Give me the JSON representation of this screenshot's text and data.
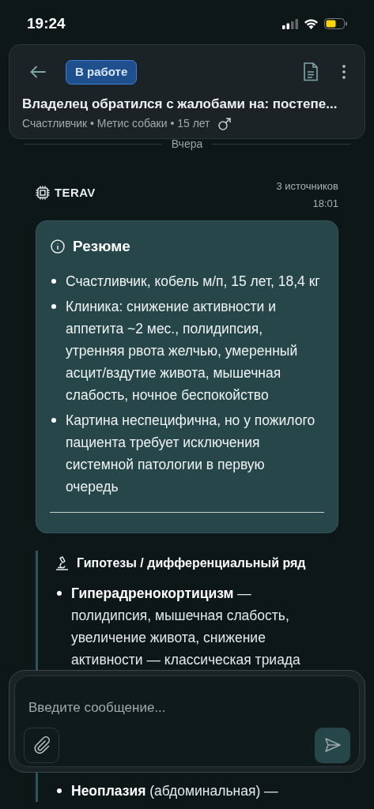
{
  "status_bar": {
    "time": "19:24"
  },
  "header": {
    "status_badge": "В работе",
    "title": "Владелец обратился с жалобами на: постепе...",
    "subtitle": "Счастливчик • Метис собаки • 15 лет"
  },
  "date_divider": "Вчера",
  "message": {
    "sender": "TERAV",
    "sources": "3 источников",
    "time": "18:01",
    "summary": {
      "title": "Резюме",
      "items": [
        "Счастливчик, кобель м/п, 15 лет, 18,4 кг",
        "Клиника: снижение активности и аппетита ~2 мес., полидипсия, утренняя рвота желчью, умеренный асцит/вздутие живота, мышечная слабость, ночное беспокойство",
        "Картина неспецифична, но у пожилого пациента требует исключения системной патологии в первую очередь"
      ]
    },
    "hypotheses": {
      "title": "Гипотезы / дифференциальный ряд",
      "items": [
        "**Гиперадренокортицизм** — полидипсия, мышечная слабость, увеличение живота, снижение активности — классическая триада",
        "**Неоплазия** (абдоминальная) —"
      ]
    }
  },
  "composer": {
    "placeholder": "Введите сообщение..."
  }
}
